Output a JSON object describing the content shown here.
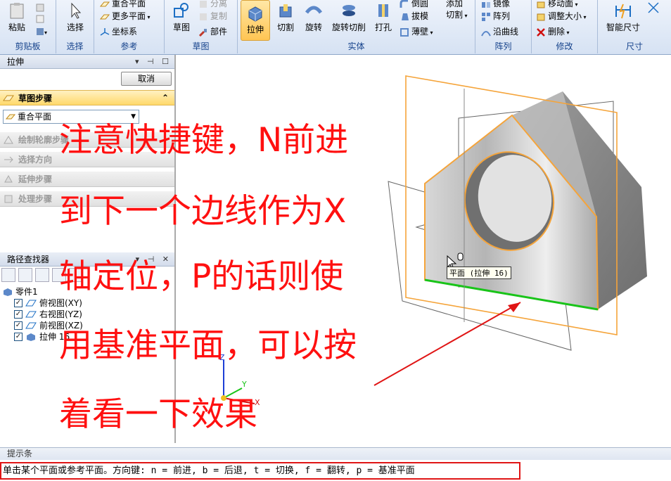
{
  "ribbon": {
    "groups": {
      "clipboard": "剪贴板",
      "select": "选择",
      "reference": "参考",
      "sketch": "草图",
      "solid": "实体",
      "pattern": "阵列",
      "modify": "修改",
      "dimension": "尺寸"
    },
    "buttons": {
      "paste": "粘贴",
      "select": "选择",
      "coincident_plane": "重合平面",
      "more_planes": "更多平面",
      "coord_sys": "坐标系",
      "sketch": "草图",
      "separate": "分离",
      "copy": "复制",
      "part": "部件",
      "extrude": "拉伸",
      "cut": "切割",
      "revolve": "旋转",
      "revolve_cut": "旋转切削",
      "hole": "打孔",
      "round": "倒圆",
      "draft": "拔模",
      "thin_wall": "薄壁",
      "add": "添加",
      "cut2": "切割",
      "mirror": "镜像",
      "pattern": "阵列",
      "along_curve": "沿曲线",
      "move_face": "移动面",
      "resize": "调整大小",
      "delete": "删除",
      "smart_dim": "智能尺寸"
    }
  },
  "command_bar": {
    "title": "拉伸",
    "cancel": "取消",
    "steps": {
      "sketch_step": "草图步骤",
      "draw_profile": "绘制轮廓步骤",
      "select_side": "选择方向",
      "extent_step": "延伸步骤",
      "treatment_step": "处理步骤"
    },
    "plane_option": "重合平面"
  },
  "path_finder": {
    "title": "路径查找器",
    "root": "零件1",
    "items": [
      "俯视图(XY)",
      "右视图(YZ)",
      "前视图(XZ)",
      "拉伸 16"
    ]
  },
  "viewport": {
    "tooltip": "平面 (拉伸 16)",
    "axes": {
      "z": "Z",
      "y": "Y",
      "x": "X"
    }
  },
  "overlay": {
    "lines": [
      "注意快捷键，N前进",
      "到下一个边线作为X",
      "轴定位，P的话则使",
      "用基准平面，可以按",
      "着看一下效果"
    ]
  },
  "status": {
    "prompt_title": "提示条",
    "prompt_text": "单击某个平面或参考平面。方向键: n = 前进, b = 后退, t = 切换, f = 翻转, p = 基准平面"
  },
  "colors": {
    "overlay_text": "#ff1010",
    "highlight_orange": "#f5a43a",
    "edge_green": "#19c419",
    "annotation_red": "#e01515"
  }
}
